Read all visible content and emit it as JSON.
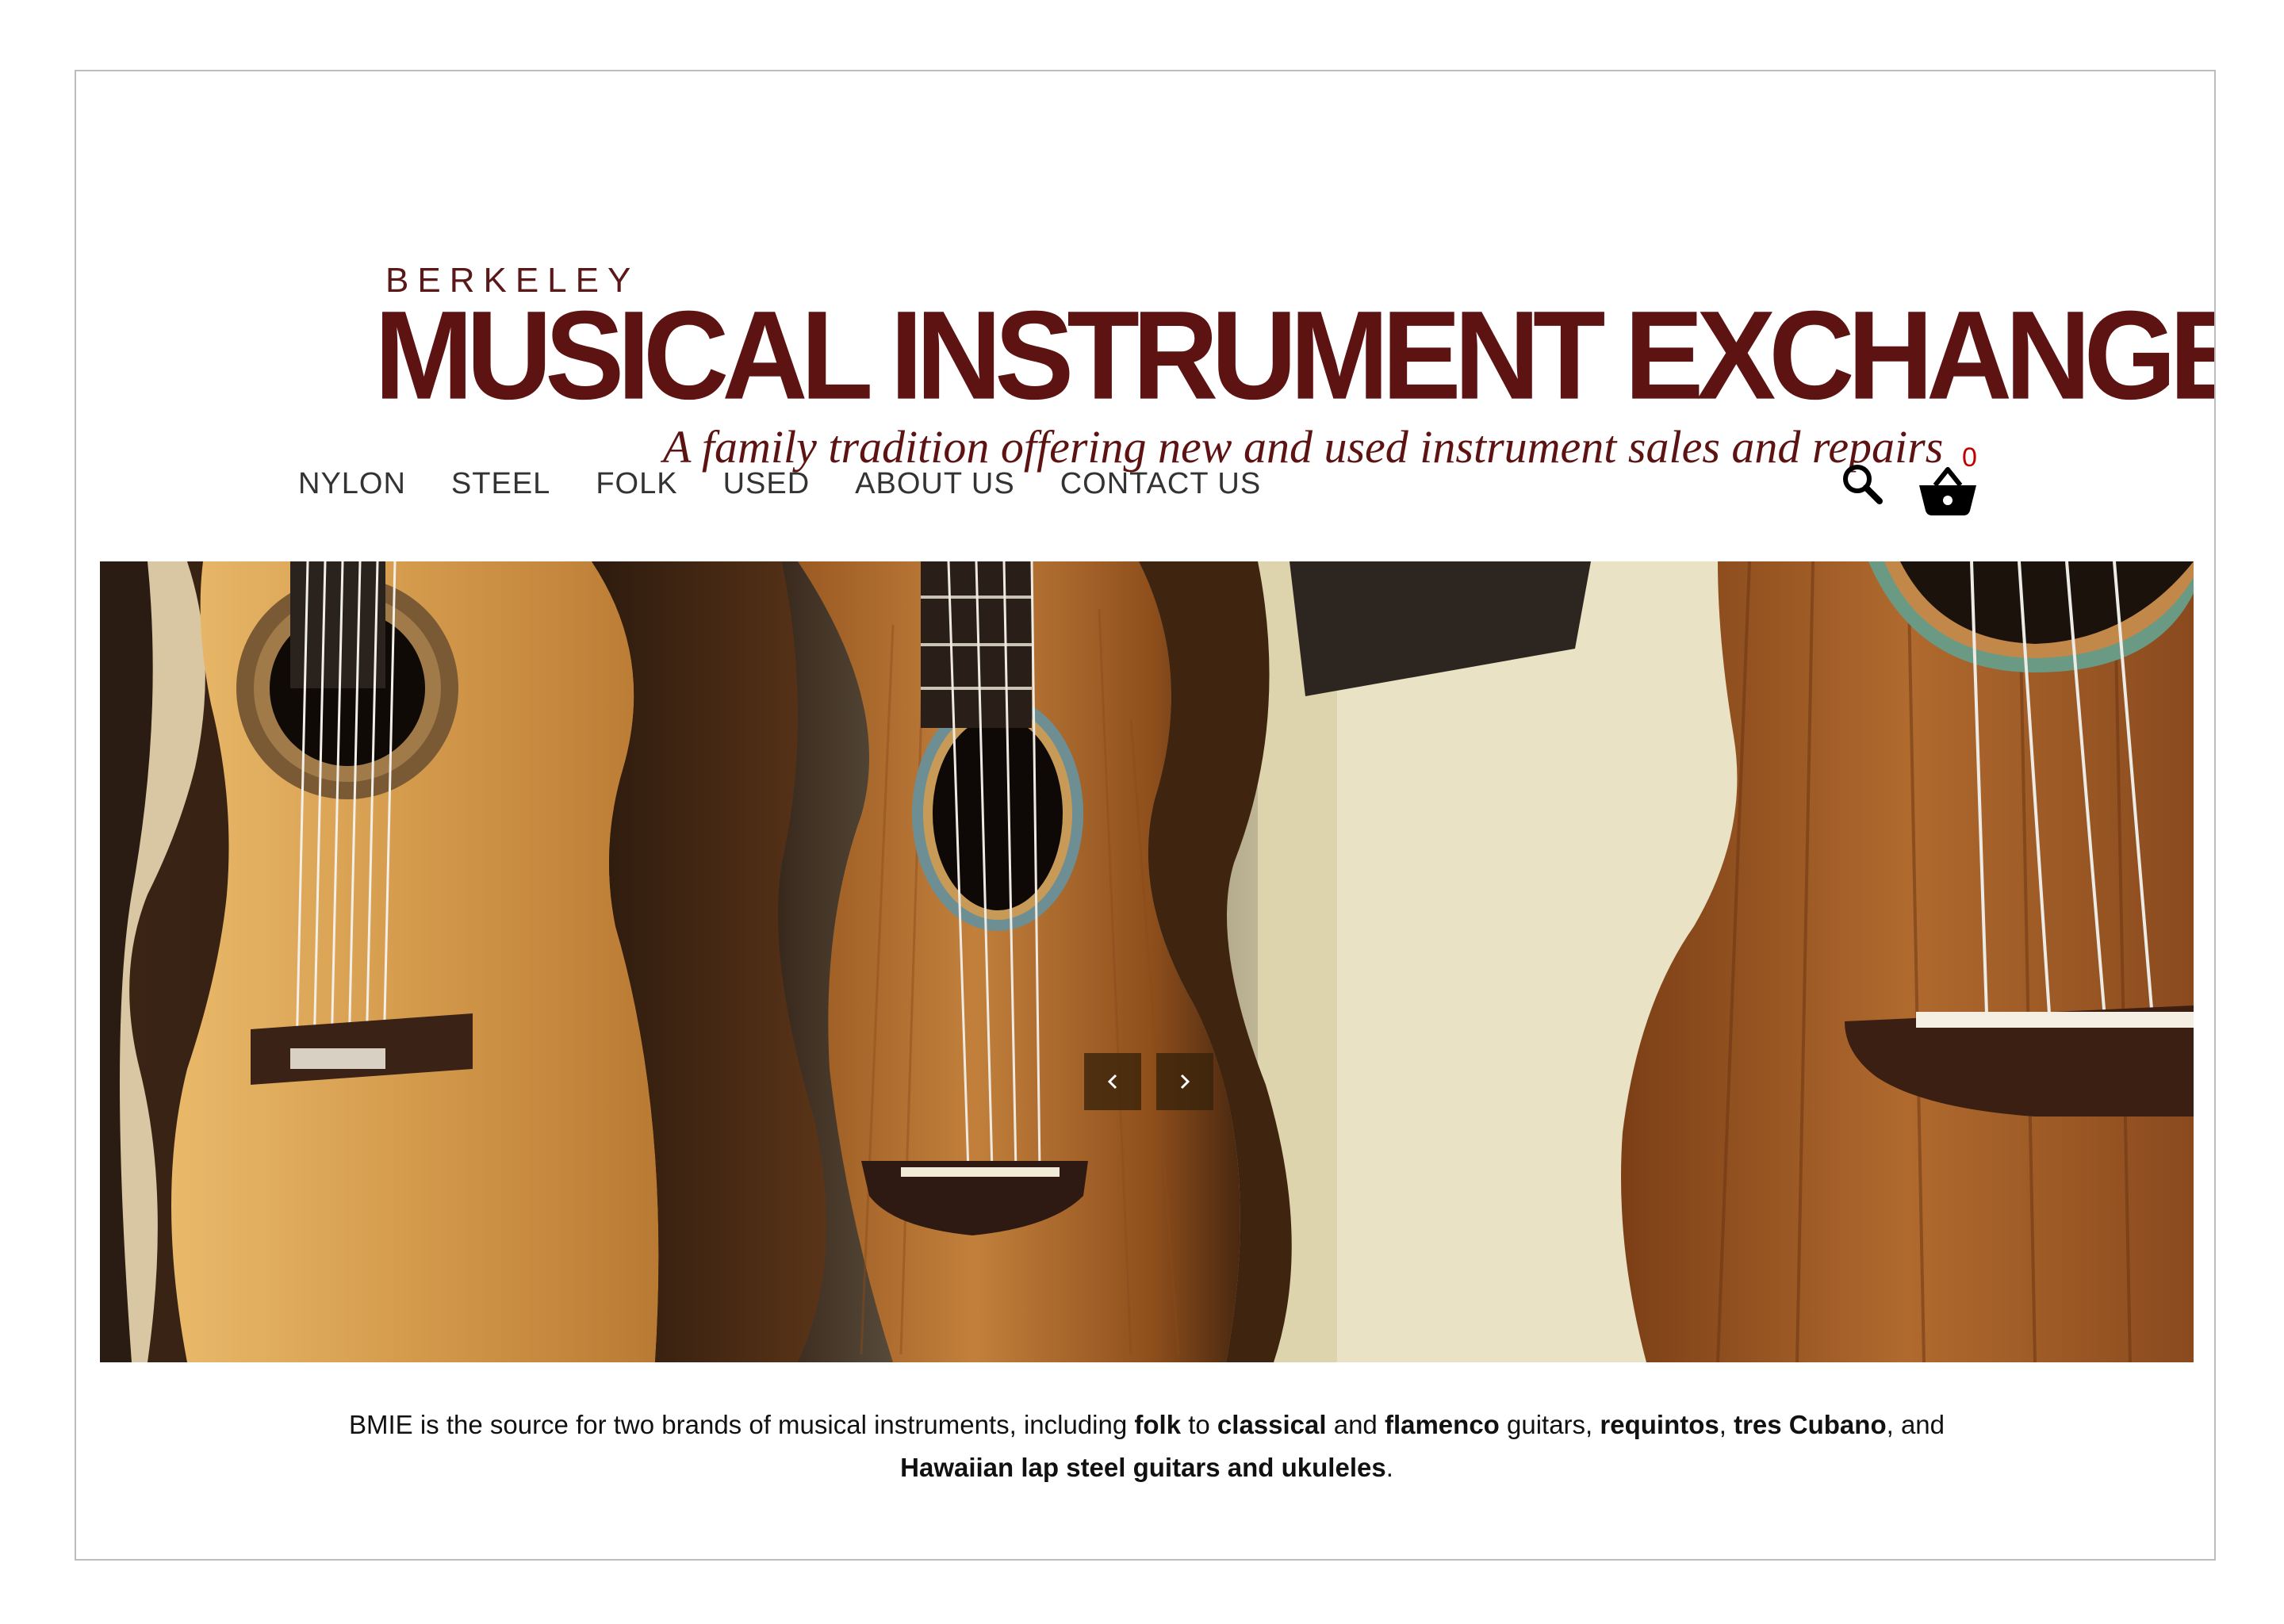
{
  "logo": {
    "top_line": "BERKELEY",
    "main": "MUSICAL INSTRUMENT EXCHANGE",
    "tagline": "A family tradition offering new and used instrument sales and repairs"
  },
  "nav": {
    "items": [
      {
        "label": "NYLON"
      },
      {
        "label": "STEEL"
      },
      {
        "label": "FOLK"
      },
      {
        "label": "USED"
      },
      {
        "label": "ABOUT US"
      },
      {
        "label": "CONTACT US"
      }
    ]
  },
  "header_icons": {
    "search": "search-icon",
    "cart": "basket-icon",
    "cart_count": "0"
  },
  "hero": {
    "prev_icon": "chevron-left-icon",
    "next_icon": "chevron-right-icon"
  },
  "intro": {
    "p1": "BMIE is the source for two brands of musical instruments, including ",
    "b1": "folk",
    "p2": " to ",
    "b2": "classical",
    "p3": " and ",
    "b3": "flamenco",
    "p4": " guitars, ",
    "b4": "requintos",
    "p5": ", ",
    "b5": "tres Cubano",
    "p6": ", and ",
    "b6": "Hawaiian lap steel guitars and ukuleles",
    "p7": "."
  },
  "colors": {
    "brand": "#5e1313",
    "cart_count": "#c00000",
    "nav_text": "#333333"
  }
}
